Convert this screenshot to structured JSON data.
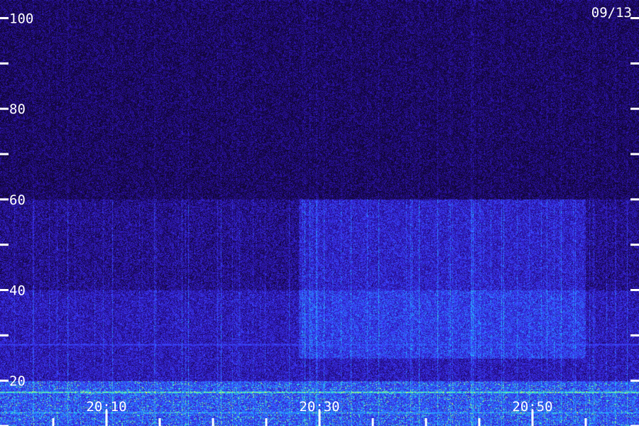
{
  "date_label": "09/13",
  "chart_data": {
    "type": "heatmap",
    "title": "",
    "xlabel": "",
    "ylabel": "",
    "grid": false,
    "y_axis": {
      "range": [
        10,
        104
      ],
      "major_ticks": [
        20,
        40,
        60,
        80,
        100
      ],
      "major_tick_labels": [
        "20",
        "40",
        "60",
        "80",
        "100"
      ],
      "minor_ticks": [
        10,
        30,
        50,
        70,
        90
      ],
      "ticks_on": [
        "left",
        "right"
      ]
    },
    "x_axis": {
      "range_minutes_after_20h": [
        0,
        60
      ],
      "major_ticks": [
        "20:10",
        "20:30",
        "20:50"
      ],
      "major_tick_labels": [
        "20:10",
        "20:30",
        "20:50"
      ],
      "minor_ticks": [
        "20:05",
        "20:15",
        "20:20",
        "20:25",
        "20:35",
        "20:40",
        "20:45",
        "20:55"
      ]
    },
    "colorscale": [
      "#100530",
      "#2a10a0",
      "#3c3cff",
      "#1eb4ff",
      "#5affa0",
      "#ffff3c"
    ],
    "intensity_bands": [
      {
        "y_min": 10,
        "y_max": 20,
        "level": 0.75
      },
      {
        "y_min": 20,
        "y_max": 40,
        "level": 0.45
      },
      {
        "y_min": 40,
        "y_max": 60,
        "level": 0.3
      },
      {
        "y_min": 60,
        "y_max": 104,
        "level": 0.15
      }
    ],
    "bright_lines": [
      {
        "y": 17.5,
        "level": 0.95
      },
      {
        "y": 13,
        "level": 0.7
      },
      {
        "y": 28,
        "level": 0.5
      }
    ],
    "bright_region_minutes": [
      28,
      55
    ]
  }
}
